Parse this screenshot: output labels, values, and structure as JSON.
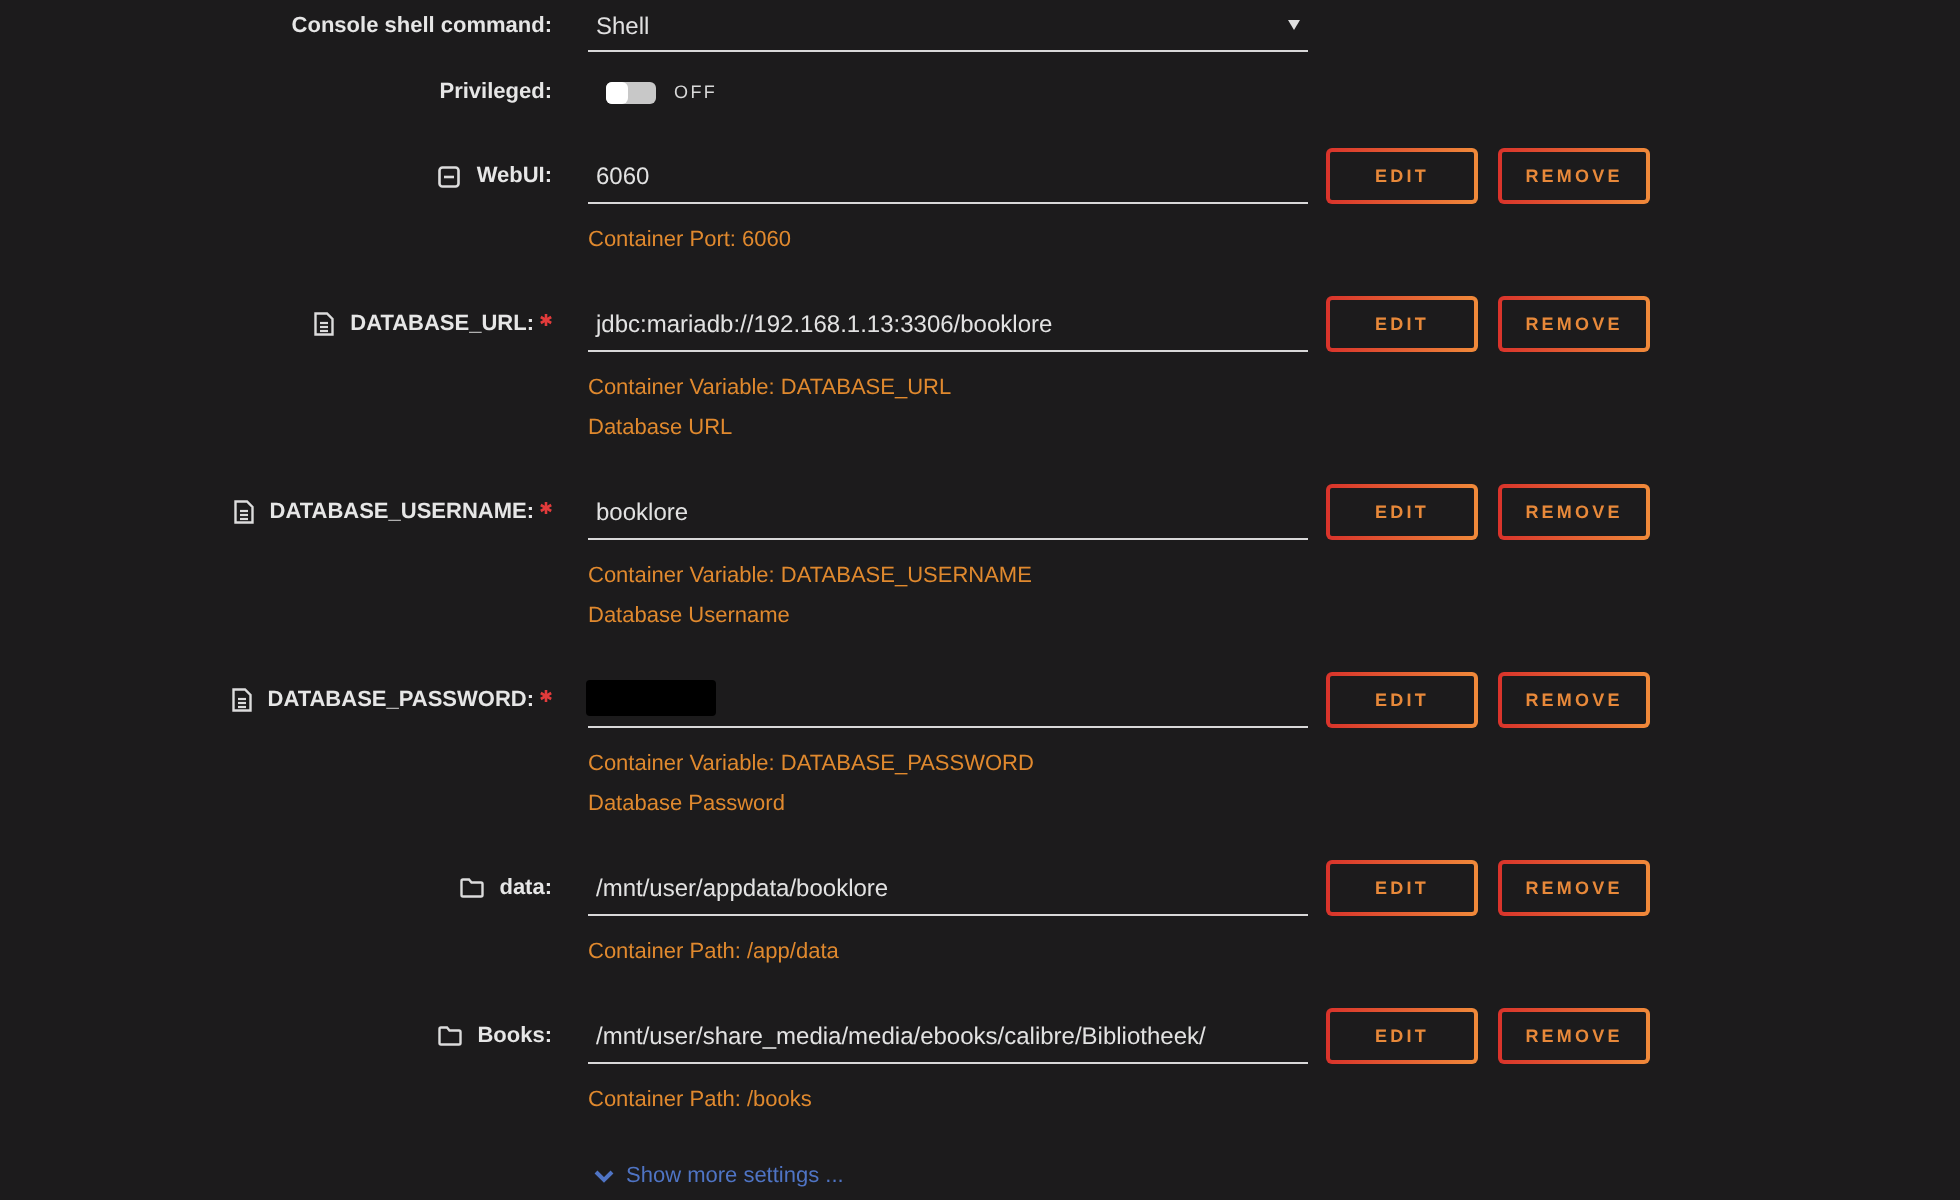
{
  "settings": [
    {
      "kind": "select",
      "label": "Console shell command:",
      "value": "Shell"
    },
    {
      "kind": "toggle",
      "label": "Privileged:",
      "on": false,
      "state_label": "OFF"
    }
  ],
  "config_items": [
    {
      "kind": "port",
      "label": "WebUI:",
      "required": false,
      "redacted": false,
      "value": "6060",
      "notes": [
        "Container Port: 6060"
      ],
      "buttons": [
        "EDIT",
        "REMOVE"
      ]
    },
    {
      "kind": "variable",
      "label": "DATABASE_URL:",
      "required": true,
      "redacted": false,
      "value": "jdbc:mariadb://192.168.1.13:3306/booklore",
      "notes": [
        "Container Variable: DATABASE_URL",
        "Database URL"
      ],
      "buttons": [
        "EDIT",
        "REMOVE"
      ]
    },
    {
      "kind": "variable",
      "label": "DATABASE_USERNAME:",
      "required": true,
      "redacted": false,
      "value": "booklore",
      "notes": [
        "Container Variable: DATABASE_USERNAME",
        "Database Username"
      ],
      "buttons": [
        "EDIT",
        "REMOVE"
      ]
    },
    {
      "kind": "variable",
      "label": "DATABASE_PASSWORD:",
      "required": true,
      "redacted": true,
      "notes": [
        "Container Variable: DATABASE_PASSWORD",
        "Database Password"
      ],
      "buttons": [
        "EDIT",
        "REMOVE"
      ]
    },
    {
      "kind": "path",
      "label": "data:",
      "required": false,
      "redacted": false,
      "value": "/mnt/user/appdata/booklore",
      "notes": [
        "Container Path: /app/data"
      ],
      "buttons": [
        "EDIT",
        "REMOVE"
      ]
    },
    {
      "kind": "path",
      "label": "Books:",
      "required": false,
      "redacted": false,
      "value": "/mnt/user/share_media/media/ebooks/calibre/Bibliotheek/",
      "notes": [
        "Container Path: /books"
      ],
      "buttons": [
        "EDIT",
        "REMOVE"
      ]
    }
  ],
  "show_more": {
    "label": "Show more settings ..."
  }
}
